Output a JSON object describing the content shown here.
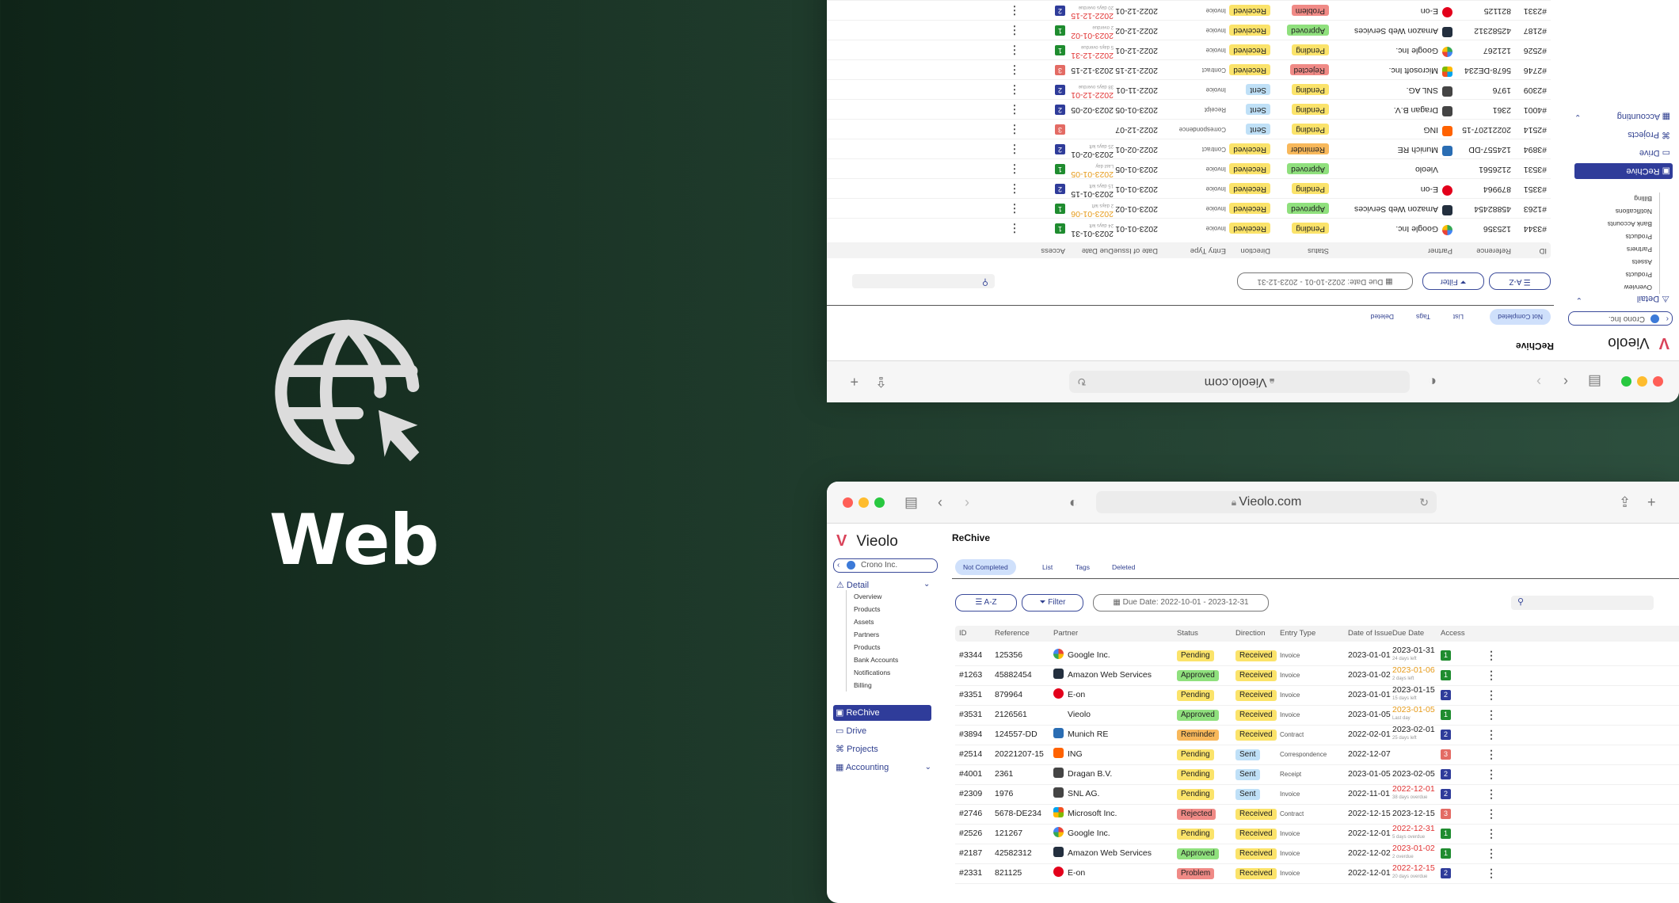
{
  "hero": {
    "label": "Web",
    "icon": "globe-cursor-icon"
  },
  "browser": {
    "url": "Vieolo.com",
    "buttons": [
      "sidebar-toggle-icon",
      "back-icon",
      "forward-icon",
      "shield-icon",
      "reload-icon",
      "share-icon",
      "new-tab-icon",
      "tabs-overview-icon"
    ]
  },
  "app": {
    "brand": "Vieolo",
    "company": "Crono Inc.",
    "page_title": "ReChive",
    "sidebar": {
      "detail_label": "Detail",
      "detail_items": [
        "Overview",
        "Products",
        "Assets",
        "Partners",
        "Products",
        "Bank Accounts",
        "Notifications",
        "Billing"
      ],
      "nav": [
        {
          "label": "ReChive",
          "active": true
        },
        {
          "label": "Drive"
        },
        {
          "label": "Projects"
        },
        {
          "label": "Accounting"
        }
      ]
    },
    "tabs": [
      "Not Completed",
      "List",
      "Tags",
      "Deleted"
    ],
    "controls": {
      "sort": "A-Z",
      "filter": "Filter",
      "date_range": "Due Date: 2022-10-01 - 2023-12-31",
      "add": "+"
    },
    "columns": [
      "ID",
      "Reference",
      "Partner",
      "Status",
      "Direction",
      "Entry Type",
      "Date of Issue",
      "Due Date",
      "Access"
    ],
    "rows": [
      {
        "id": "#3344",
        "ref": "125356",
        "partner": "Google Inc.",
        "logo": "google",
        "status": "Pending",
        "direction": "Received",
        "type": "Invoice",
        "issue": "2023-01-01",
        "due": "2023-01-31",
        "due_note": "24 days left",
        "due_color": "normal",
        "access": "1"
      },
      {
        "id": "#1263",
        "ref": "45882454",
        "partner": "Amazon Web Services",
        "logo": "aws",
        "status": "Approved",
        "direction": "Received",
        "type": "Invoice",
        "issue": "2023-01-02",
        "due": "2023-01-06",
        "due_note": "2 days left",
        "due_color": "warn",
        "access": "1"
      },
      {
        "id": "#3351",
        "ref": "879964",
        "partner": "E-on",
        "logo": "eon",
        "status": "Pending",
        "direction": "Received",
        "type": "Invoice",
        "issue": "2023-01-01",
        "due": "2023-01-15",
        "due_note": "15 days left",
        "due_color": "normal",
        "access": "2"
      },
      {
        "id": "#3531",
        "ref": "2126561",
        "partner": "Vieolo",
        "logo": "vieolo",
        "status": "Approved",
        "direction": "Received",
        "type": "Invoice",
        "issue": "2023-01-05",
        "due": "2023-01-05",
        "due_note": "Last day",
        "due_color": "warn",
        "access": "1"
      },
      {
        "id": "#3894",
        "ref": "124557-DD",
        "partner": "Munich RE",
        "logo": "munich",
        "status": "Reminder",
        "direction": "Received",
        "type": "Contract",
        "issue": "2022-02-01",
        "due": "2023-02-01",
        "due_note": "25 days left",
        "due_color": "normal",
        "access": "2"
      },
      {
        "id": "#2514",
        "ref": "20221207-15",
        "partner": "ING",
        "logo": "ing",
        "status": "Pending",
        "direction": "Sent",
        "type": "Correspondence",
        "issue": "2022-12-07",
        "due": "",
        "due_note": "",
        "due_color": "normal",
        "access": "3"
      },
      {
        "id": "#4001",
        "ref": "2361",
        "partner": "Dragan B.V.",
        "logo": "generic",
        "status": "Pending",
        "direction": "Sent",
        "type": "Receipt",
        "issue": "2023-01-05",
        "due": "2023-02-05",
        "due_note": "",
        "due_color": "normal",
        "access": "2"
      },
      {
        "id": "#2309",
        "ref": "1976",
        "partner": "SNL AG.",
        "logo": "generic",
        "status": "Pending",
        "direction": "Sent",
        "type": "Invoice",
        "issue": "2022-11-01",
        "due": "2022-12-01",
        "due_note": "38 days overdue",
        "due_color": "over",
        "access": "2"
      },
      {
        "id": "#2746",
        "ref": "5678-DE234",
        "partner": "Microsoft Inc.",
        "logo": "microsoft",
        "status": "Rejected",
        "direction": "Received",
        "type": "Contract",
        "issue": "2022-12-15",
        "due": "2023-12-15",
        "due_note": "",
        "due_color": "normal",
        "access": "3"
      },
      {
        "id": "#2526",
        "ref": "121267",
        "partner": "Google Inc.",
        "logo": "google",
        "status": "Pending",
        "direction": "Received",
        "type": "Invoice",
        "issue": "2022-12-01",
        "due": "2022-12-31",
        "due_note": "5 days overdue",
        "due_color": "over",
        "access": "1"
      },
      {
        "id": "#2187",
        "ref": "42582312",
        "partner": "Amazon Web Services",
        "logo": "aws",
        "status": "Approved",
        "direction": "Received",
        "type": "Invoice",
        "issue": "2022-12-02",
        "due": "2023-01-02",
        "due_note": "2 overdue",
        "due_color": "over",
        "access": "1"
      },
      {
        "id": "#2331",
        "ref": "821125",
        "partner": "E-on",
        "logo": "eon",
        "status": "Problem",
        "direction": "Received",
        "type": "Invoice",
        "issue": "2022-12-01",
        "due": "2022-12-15",
        "due_note": "20 days overdue",
        "due_color": "over",
        "access": "2"
      }
    ]
  },
  "colors": {
    "accent": "#2f3c9a",
    "status": {
      "Pending": "#fbe36a",
      "Approved": "#8fe07d",
      "Reminder": "#f8b85b",
      "Rejected": "#f08a86",
      "Problem": "#f08a86"
    },
    "direction": {
      "Received": "#fbe36a",
      "Sent": "#bfe0f7"
    },
    "access": {
      "1": "#1f8c2f",
      "2": "#2f3c9a",
      "3": "#e36b64"
    },
    "due": {
      "normal": "#222222",
      "warn": "#e69a18",
      "over": "#e03131"
    }
  }
}
